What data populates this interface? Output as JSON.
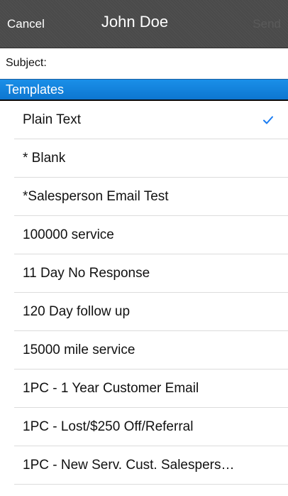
{
  "navbar": {
    "cancel_label": "Cancel",
    "title": "John Doe",
    "send_label": "Send"
  },
  "subject": {
    "label": "Subject:",
    "value": ""
  },
  "templates": {
    "header": "Templates",
    "items": [
      {
        "label": "Plain Text",
        "selected": true
      },
      {
        "label": "* Blank",
        "selected": false
      },
      {
        "label": "*Salesperson Email Test",
        "selected": false
      },
      {
        "label": "100000 service",
        "selected": false
      },
      {
        "label": "11 Day No Response",
        "selected": false
      },
      {
        "label": "120 Day follow up",
        "selected": false
      },
      {
        "label": "15000 mile service",
        "selected": false
      },
      {
        "label": "1PC - 1 Year Customer Email",
        "selected": false
      },
      {
        "label": "1PC - Lost/$250 Off/Referral",
        "selected": false
      },
      {
        "label": "1PC - New Serv. Cust. Salespers…",
        "selected": false
      }
    ]
  },
  "colors": {
    "navbar_bg": "#4a4a4a",
    "header_blue": "#0d76d0",
    "check_blue": "#1a7cf2",
    "send_disabled": "#5a5a5a"
  },
  "icons": {
    "selected": "checkmark-icon"
  }
}
